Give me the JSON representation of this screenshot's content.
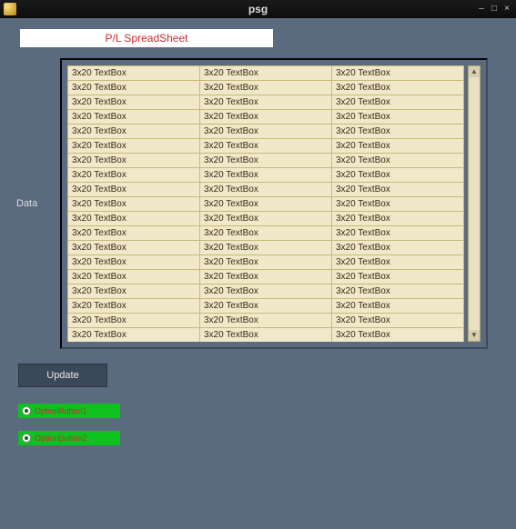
{
  "titlebar": {
    "title": "psg",
    "min": "–",
    "max": "□",
    "close": "×"
  },
  "heading": "P/L SpreadSheet",
  "data_label": "Data",
  "grid": {
    "rows": 20,
    "cols": 3,
    "cell_text": "3x20 TextBox"
  },
  "update_label": "Update",
  "radios": [
    {
      "label": "OptionButton1",
      "selected": true
    },
    {
      "label": "OptionButton2",
      "selected": true
    }
  ],
  "scrollbar": {
    "up": "▲",
    "down": "▼"
  }
}
